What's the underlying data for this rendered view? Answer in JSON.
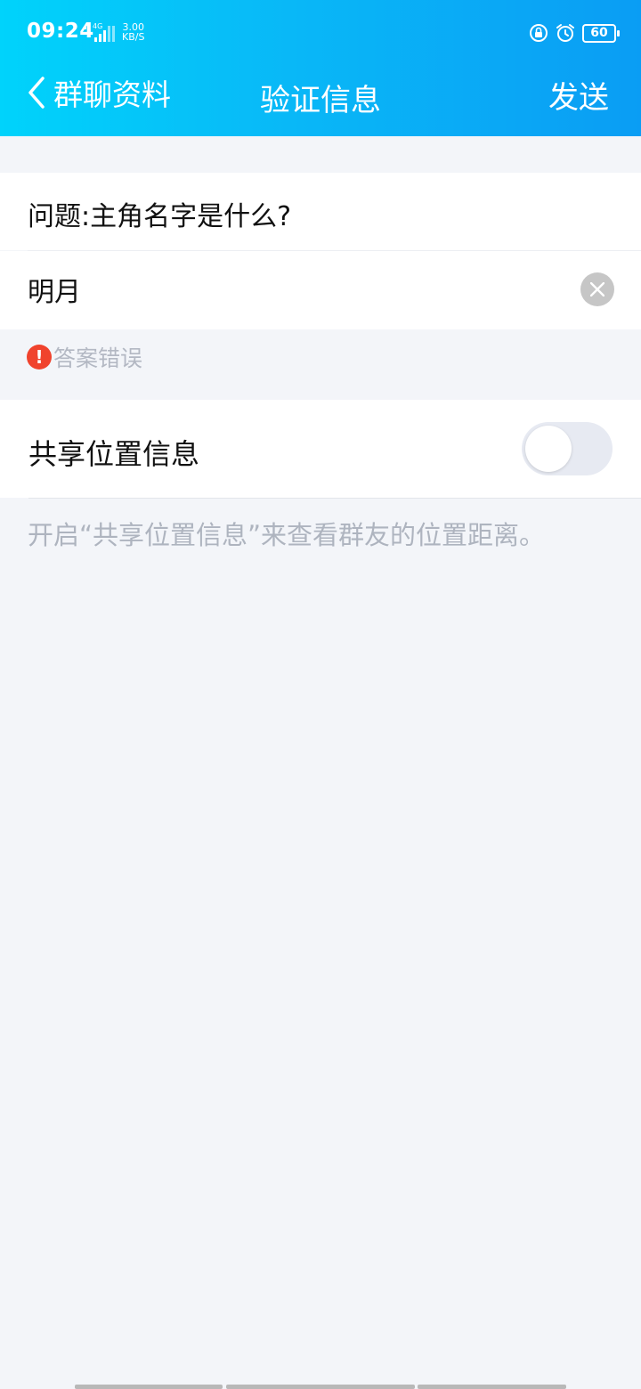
{
  "status_bar": {
    "time": "09:24",
    "network": "4G",
    "speed_value": "3.00",
    "speed_unit": "KB/S",
    "battery": "60"
  },
  "nav": {
    "back_label": "群聊资料",
    "title": "验证信息",
    "send_label": "发送"
  },
  "form": {
    "question": "问题:主角名字是什么?",
    "answer_value": "明月",
    "error_icon": "!",
    "error_text": "答案错误"
  },
  "share_location": {
    "label": "共享位置信息",
    "enabled": false,
    "hint": "开启“共享位置信息”来查看群友的位置距离。"
  },
  "colors": {
    "header_start": "#00d3fb",
    "header_end": "#0a9df4",
    "error": "#f0432d",
    "background": "#f3f5f9"
  }
}
